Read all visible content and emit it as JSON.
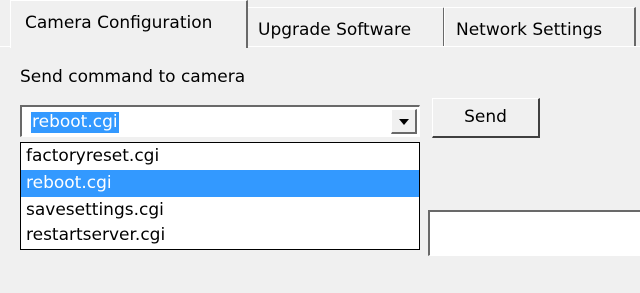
{
  "tabs": [
    {
      "label": "Camera Configuration",
      "active": true
    },
    {
      "label": "Upgrade Software",
      "active": false
    },
    {
      "label": "Network Settings",
      "active": false
    }
  ],
  "command": {
    "label": "Send command to camera",
    "selected_value": "reboot.cgi",
    "send_label": "Send",
    "options": [
      "factoryreset.cgi",
      "reboot.cgi",
      "savesettings.cgi",
      "restartserver.cgi"
    ],
    "highlighted_option": "reboot.cgi"
  },
  "text_field": {
    "value": ""
  },
  "colors": {
    "selection": "#3399ff",
    "background": "#f0f0f0",
    "shadow": "#696969",
    "highlight": "#ffffff"
  },
  "icons": {
    "dropdown_arrow": "triangle-down-icon"
  }
}
